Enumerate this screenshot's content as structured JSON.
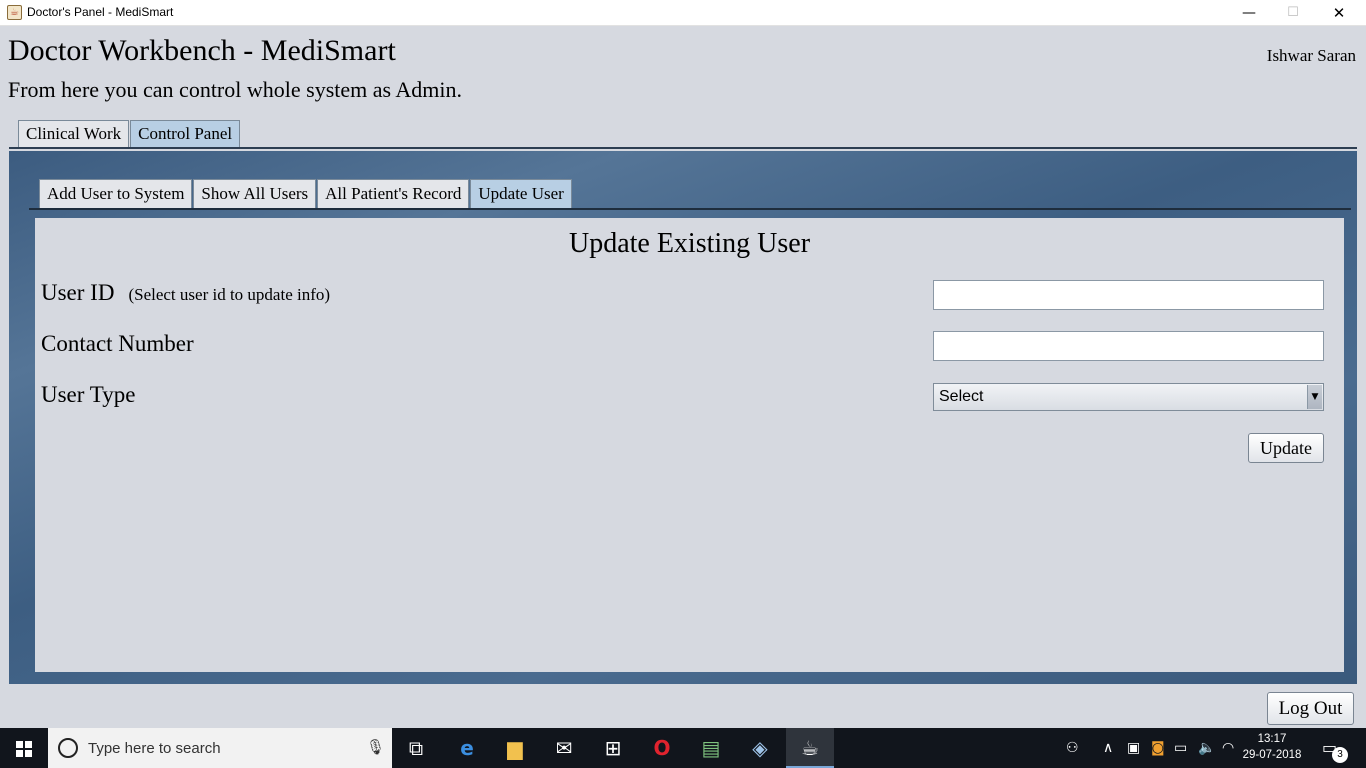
{
  "window": {
    "title": "Doctor's Panel - MediSmart",
    "min_glyph": "—",
    "max_glyph": "☐",
    "close_glyph": "✕"
  },
  "header": {
    "title": "Doctor Workbench - MediSmart",
    "subtitle": "From here you can control whole system as Admin.",
    "user_name": "Ishwar Saran"
  },
  "outer_tabs": [
    {
      "label": "Clinical Work",
      "active": false
    },
    {
      "label": "Control Panel",
      "active": true
    }
  ],
  "inner_tabs": [
    {
      "label": "Add User to System",
      "active": false
    },
    {
      "label": "Show All Users",
      "active": false
    },
    {
      "label": "All Patient's Record",
      "active": false
    },
    {
      "label": "Update User",
      "active": true
    }
  ],
  "form": {
    "title": "Update Existing User",
    "user_id_label": "User ID",
    "user_id_hint": "(Select user id to update info)",
    "user_id_value": "",
    "contact_label": "Contact Number",
    "contact_value": "",
    "user_type_label": "User Type",
    "user_type_selected": "Select",
    "update_button": "Update"
  },
  "logout_button": "Log Out",
  "taskbar": {
    "search_placeholder": "Type here to search",
    "apps": [
      "task-view-icon",
      "edge-icon",
      "file-explorer-icon",
      "mail-icon",
      "store-icon",
      "opera-icon",
      "app-icon",
      "virtualbox-icon",
      "java-icon"
    ],
    "time": "13:17",
    "date": "29-07-2018",
    "notification_count": "3"
  }
}
